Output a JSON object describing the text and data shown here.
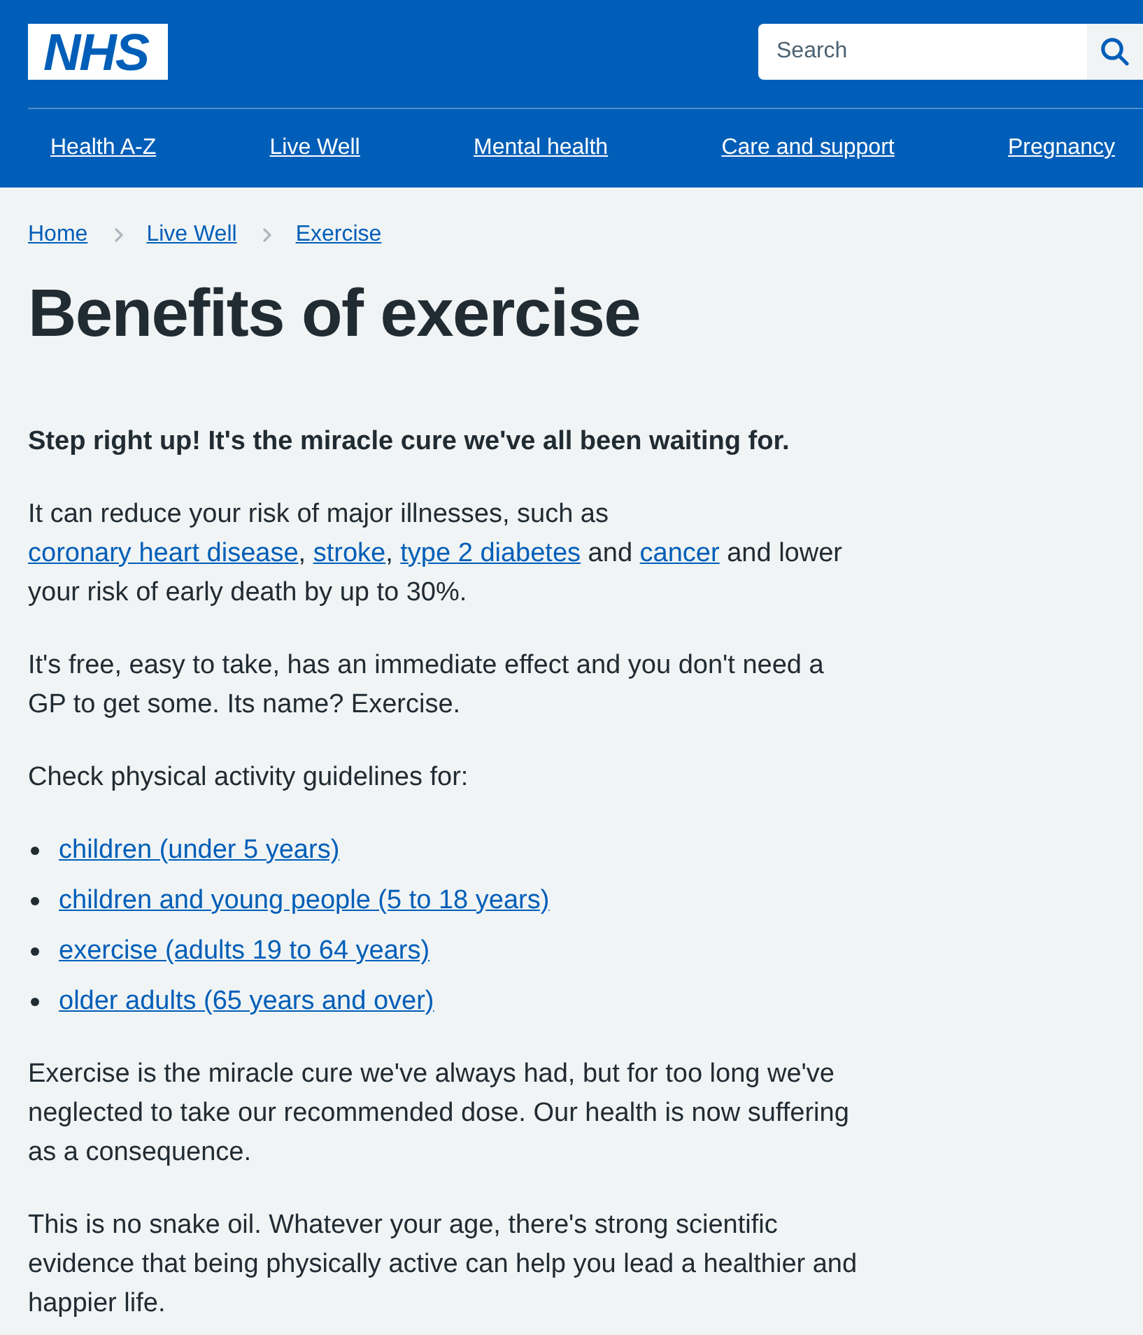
{
  "header": {
    "logo": "NHS",
    "search": {
      "placeholder": "Search"
    },
    "nav": [
      {
        "label": "Health A-Z"
      },
      {
        "label": "Live Well"
      },
      {
        "label": "Mental health"
      },
      {
        "label": "Care and support"
      },
      {
        "label": "Pregnancy"
      }
    ]
  },
  "breadcrumbs": [
    {
      "label": "Home"
    },
    {
      "label": "Live Well"
    },
    {
      "label": "Exercise"
    }
  ],
  "title": "Benefits of exercise",
  "content": [
    {
      "kind": "lead",
      "text": "Step right up! It's the miracle cure we've all been waiting for."
    },
    {
      "kind": "paragraph",
      "parts": [
        {
          "kind": "text",
          "text": "It can reduce your risk of major illnesses, such as "
        },
        {
          "kind": "link",
          "text": "coronary heart disease"
        },
        {
          "kind": "text",
          "text": ", "
        },
        {
          "kind": "link",
          "text": "stroke"
        },
        {
          "kind": "text",
          "text": ", "
        },
        {
          "kind": "link",
          "text": "type 2 diabetes"
        },
        {
          "kind": "text",
          "text": " and "
        },
        {
          "kind": "link",
          "text": "cancer"
        },
        {
          "kind": "text",
          "text": " and lower your risk of early death by up to 30%."
        }
      ]
    },
    {
      "kind": "paragraph",
      "parts": [
        {
          "kind": "text",
          "text": "It's free, easy to take, has an immediate effect and you don't need a GP to get some. Its name? Exercise."
        }
      ]
    },
    {
      "kind": "paragraph",
      "parts": [
        {
          "kind": "text",
          "text": "Check physical activity guidelines for:"
        }
      ]
    },
    {
      "kind": "link_list",
      "items": [
        {
          "label": "children (under 5 years)"
        },
        {
          "label": "children and young people (5 to 18 years)"
        },
        {
          "label": "exercise (adults 19 to 64 years)"
        },
        {
          "label": "older adults (65 years and over)"
        }
      ]
    },
    {
      "kind": "paragraph",
      "parts": [
        {
          "kind": "text",
          "text": "Exercise is the miracle cure we've always had, but for too long we've neglected to take our recommended dose. Our health is now suffering as a consequence."
        }
      ]
    },
    {
      "kind": "paragraph",
      "parts": [
        {
          "kind": "text",
          "text": "This is no snake oil. Whatever your age, there's strong scientific evidence that being physically active can help you lead a healthier and happier life."
        }
      ]
    }
  ]
}
